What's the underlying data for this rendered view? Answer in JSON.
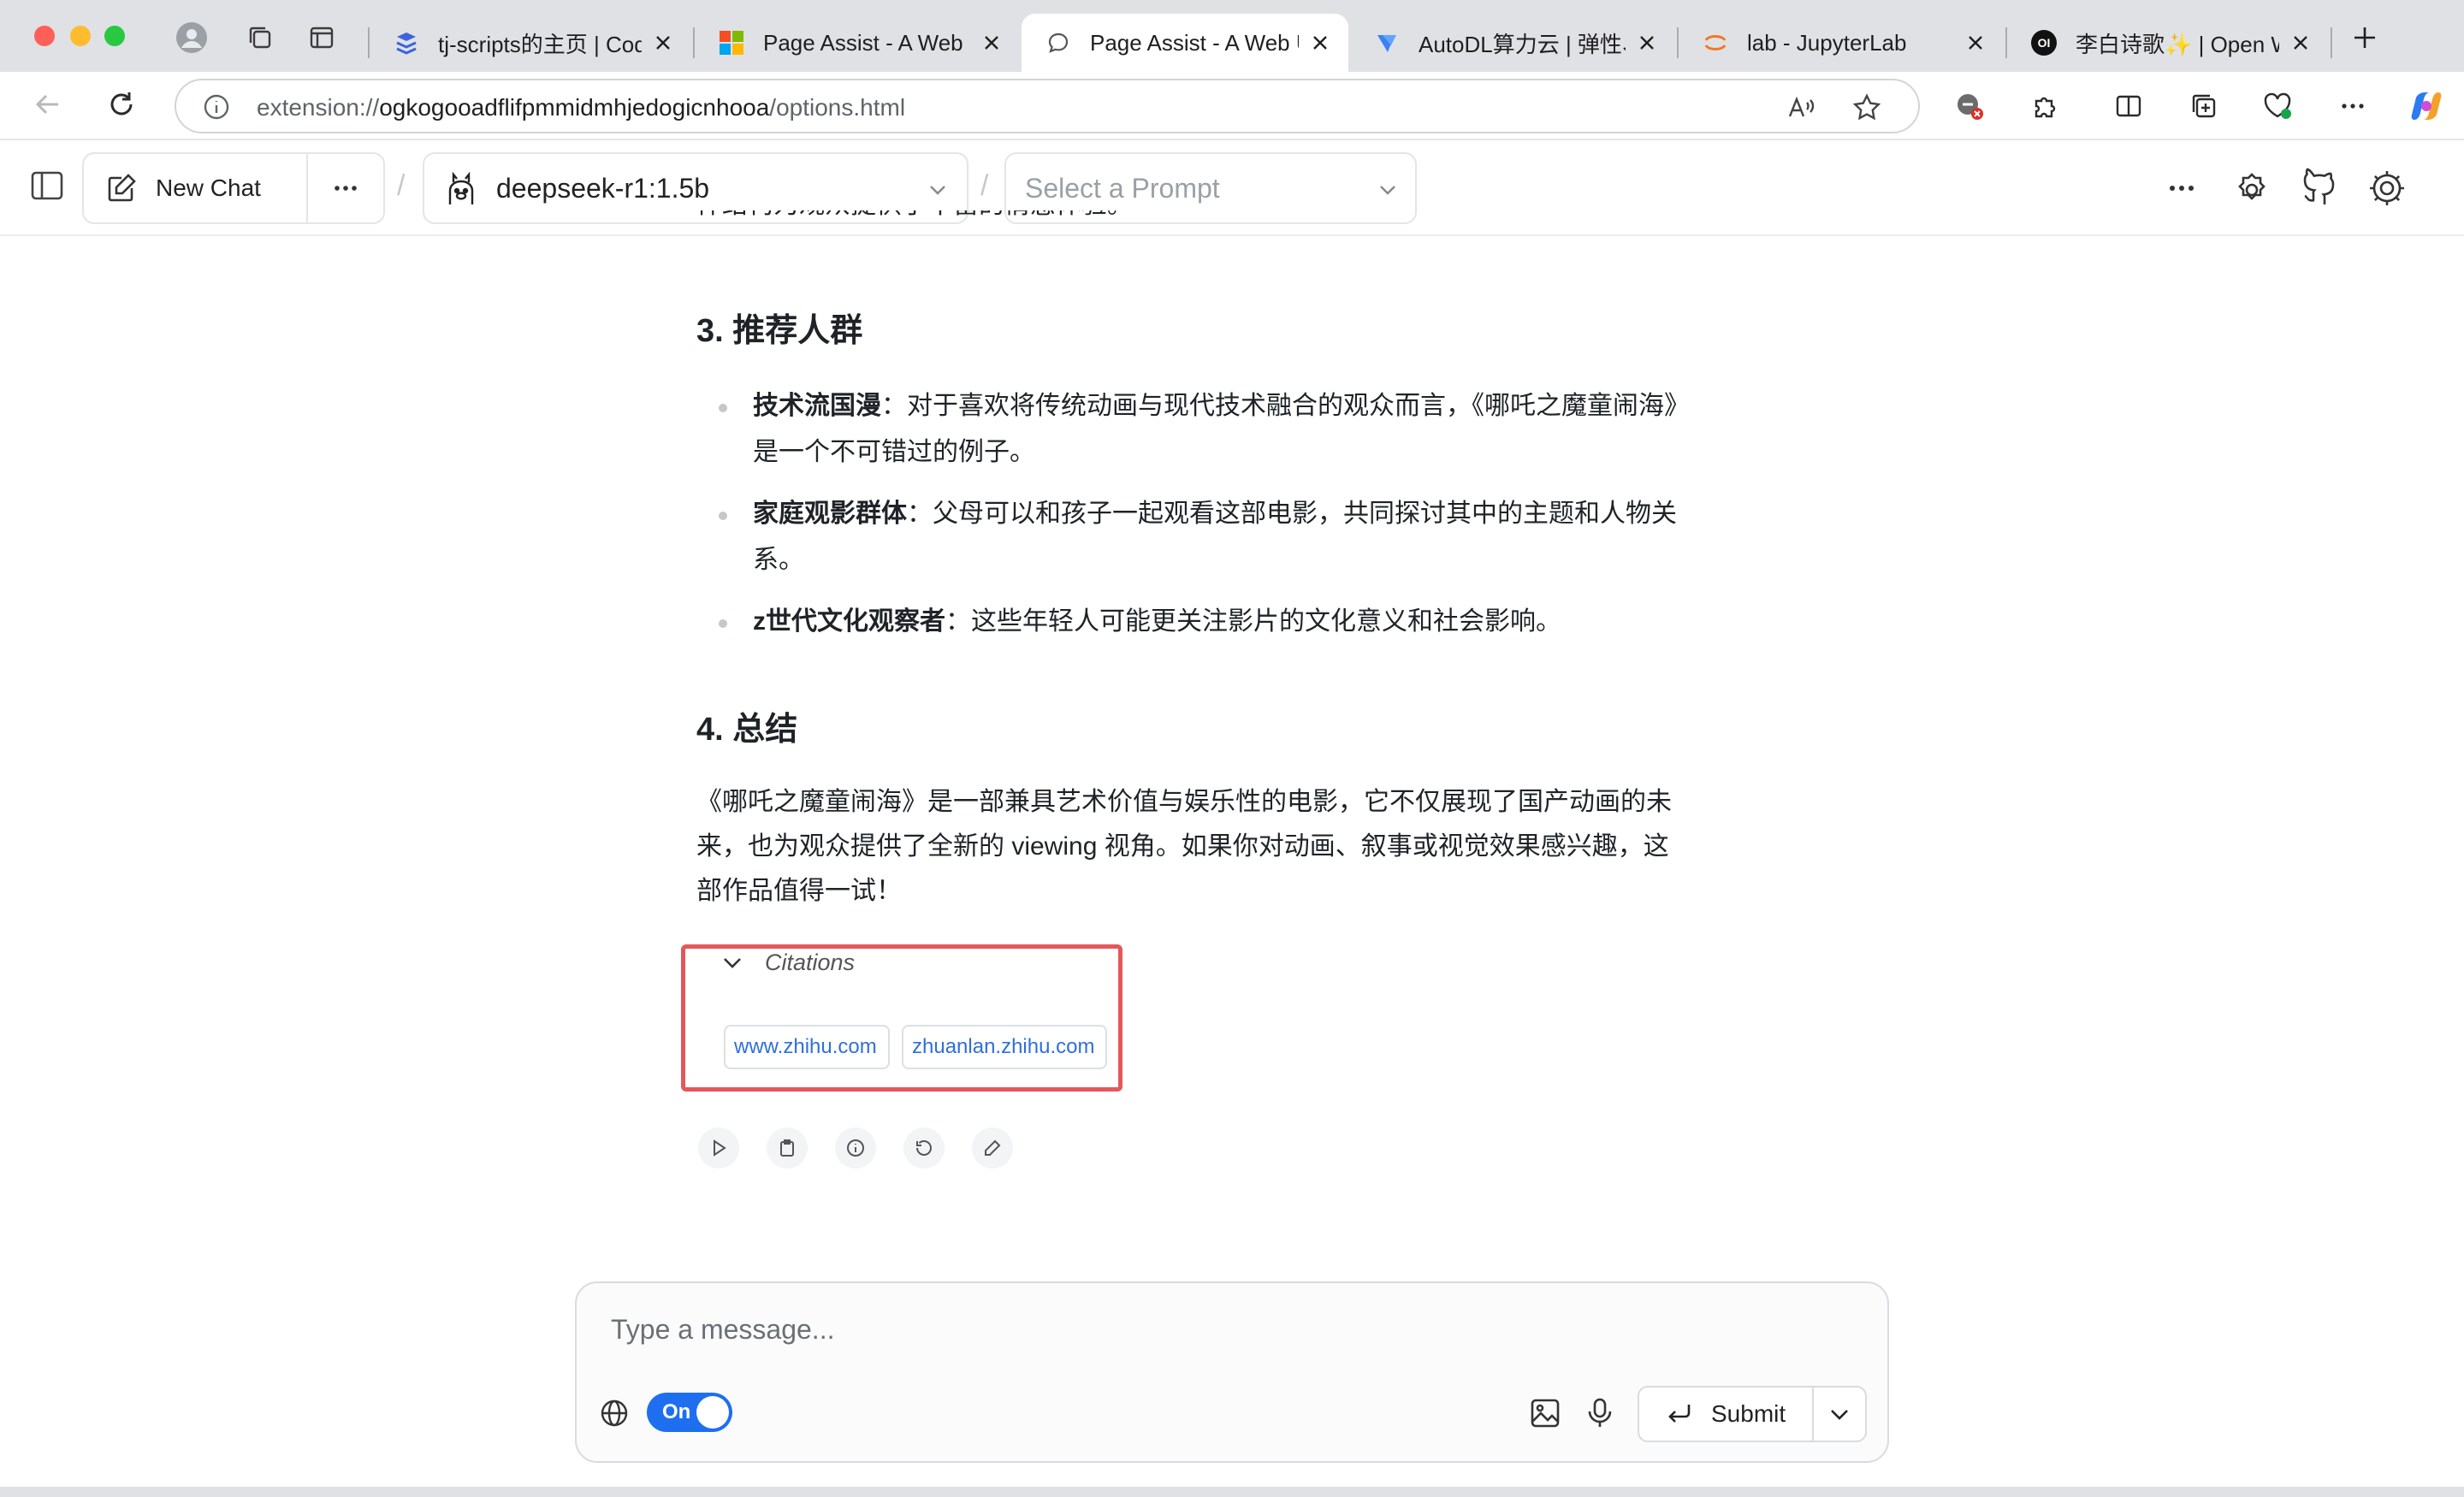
{
  "browser": {
    "tabs": [
      {
        "title": "tj-scripts的主页 | CodeWh",
        "icon": "codewhy-icon",
        "active": false
      },
      {
        "title": "Page Assist - A Web UI",
        "icon": "microsoft-icon",
        "active": false
      },
      {
        "title": "Page Assist - A Web UI",
        "icon": "chat-bubble-icon",
        "active": true
      },
      {
        "title": "AutoDL算力云 | 弹性、好",
        "icon": "autodl-icon",
        "active": false
      },
      {
        "title": "lab - JupyterLab",
        "icon": "jupyter-icon",
        "active": false
      },
      {
        "title": "李白诗歌✨ | Open WebUI",
        "icon": "openwebui-icon",
        "active": false
      }
    ],
    "url_prefix": "extension://",
    "url_host": "ogkogooadflifpmmidmhjedogicnhooa",
    "url_path": "/options.html",
    "openwebui_favicon_text": "OI"
  },
  "header": {
    "new_chat_label": "New Chat",
    "model": "deepseek-r1:1.5b",
    "prompt_placeholder": "Select a Prompt",
    "separator": "/"
  },
  "message": {
    "partial_top_line": "件结构为观众提供了丰富的情感体验。",
    "section3_title": "3. 推荐人群",
    "section3_items": [
      {
        "bold": "技术流国漫",
        "text": "：对于喜欢将传统动画与现代技术融合的观众而言，《哪吒之魔童闹海》是一个不可错过的例子。"
      },
      {
        "bold": "家庭观影群体",
        "text": "：父母可以和孩子一起观看这部电影，共同探讨其中的主题和人物关系。"
      },
      {
        "bold": "z世代文化观察者",
        "text": "：这些年轻人可能更关注影片的文化意义和社会影响。"
      }
    ],
    "section4_title": "4. 总结",
    "section4_text": "《哪吒之魔童闹海》是一部兼具艺术价值与娱乐性的电影，它不仅展现了国产动画的未来，也为观众提供了全新的 viewing 视角。如果你对动画、叙事或视觉效果感兴趣，这部作品值得一试！",
    "citations_label": "Citations",
    "citations": [
      "www.zhihu.com",
      "zhuanlan.zhihu.com"
    ]
  },
  "composer": {
    "placeholder": "Type a message...",
    "web_search_toggle": "On",
    "submit_label": "Submit"
  }
}
